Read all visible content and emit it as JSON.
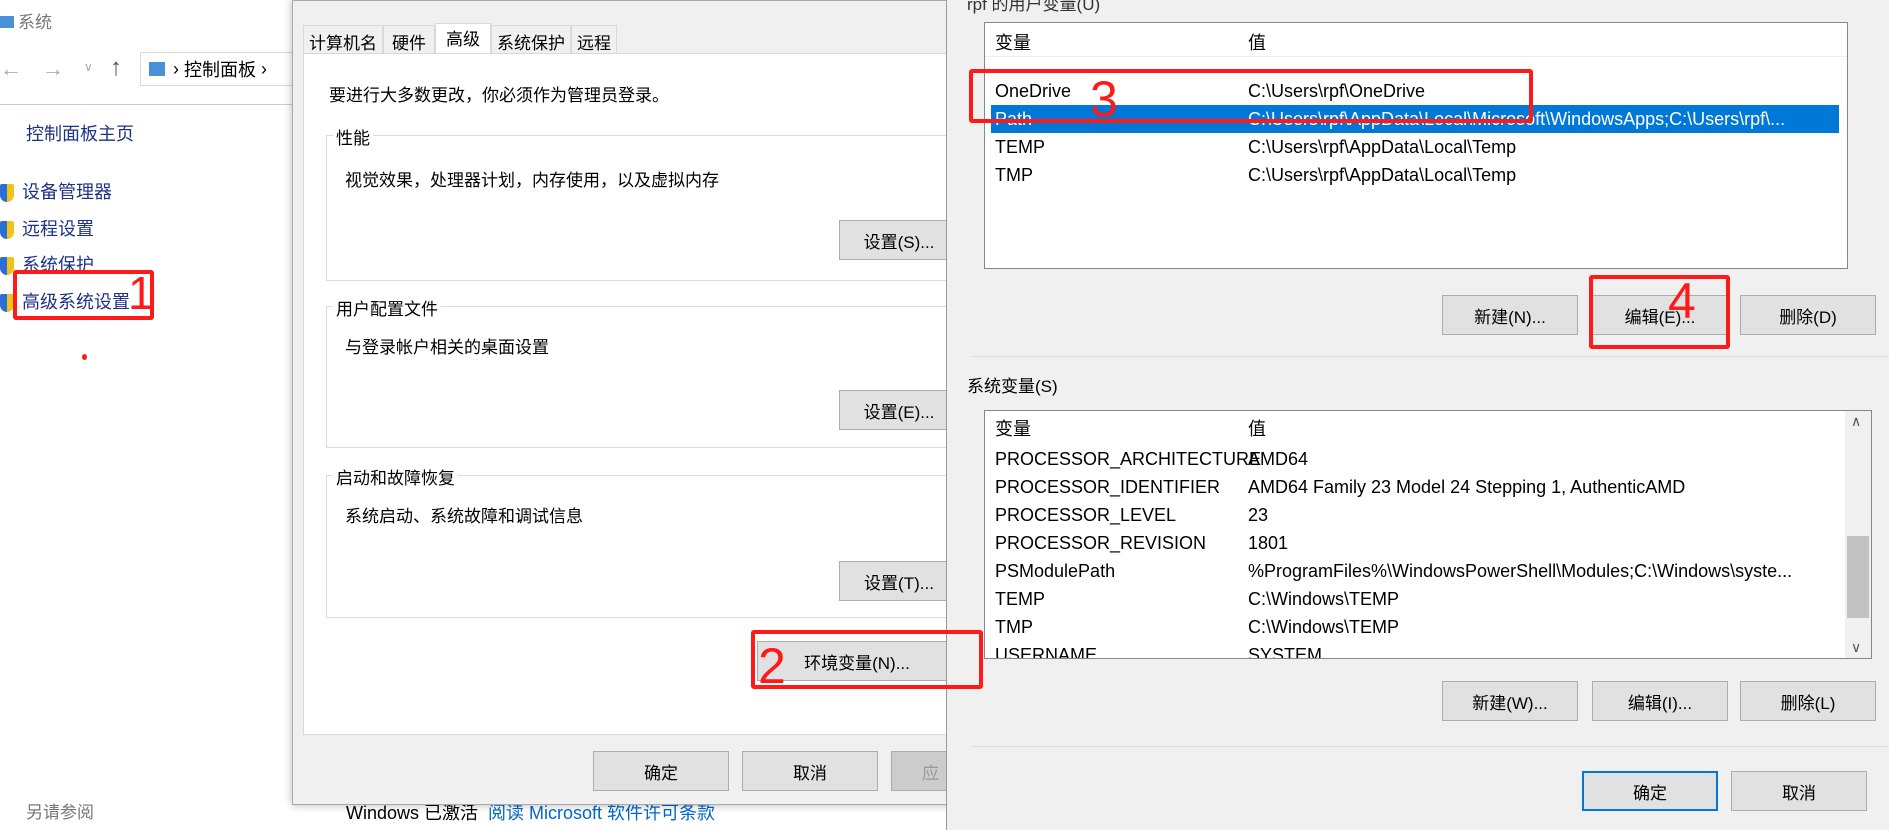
{
  "explorer": {
    "title": "系统",
    "breadcrumb": "控制面板",
    "home": "控制面板主页",
    "items": [
      "设备管理器",
      "远程设置",
      "系统保护",
      "高级系统设置"
    ],
    "see_also": "另请参阅",
    "activation": "Windows 已激活",
    "license_link": "阅读 Microsoft 软件许可条款"
  },
  "sysprops": {
    "tabs": [
      "计算机名",
      "硬件",
      "高级",
      "系统保护",
      "远程"
    ],
    "active_tab": "高级",
    "admin_note": "要进行大多数更改，你必须作为管理员登录。",
    "groups": [
      {
        "title": "性能",
        "desc": "视觉效果，处理器计划，内存使用，以及虚拟内存",
        "button": "设置(S)..."
      },
      {
        "title": "用户配置文件",
        "desc": "与登录帐户相关的桌面设置",
        "button": "设置(E)..."
      },
      {
        "title": "启动和故障恢复",
        "desc": "系统启动、系统故障和调试信息",
        "button": "设置(T)..."
      }
    ],
    "env_button": "环境变量(N)...",
    "ok": "确定",
    "cancel": "取消",
    "apply": "应"
  },
  "envvars": {
    "user_label": "rpf 的用户变量(U)",
    "col_var": "变量",
    "col_val": "值",
    "user_vars": [
      {
        "name": "OneDrive",
        "value": "C:\\Users\\rpf\\OneDrive"
      },
      {
        "name": "Path",
        "value": "C:\\Users\\rpf\\AppData\\Local\\Microsoft\\WindowsApps;C:\\Users\\rpf\\..."
      },
      {
        "name": "TEMP",
        "value": "C:\\Users\\rpf\\AppData\\Local\\Temp"
      },
      {
        "name": "TMP",
        "value": "C:\\Users\\rpf\\AppData\\Local\\Temp"
      }
    ],
    "user_buttons": [
      "新建(N)...",
      "编辑(E)...",
      "删除(D)"
    ],
    "sys_label": "系统变量(S)",
    "sys_vars": [
      {
        "name": "PROCESSOR_ARCHITECTURE",
        "value": "AMD64"
      },
      {
        "name": "PROCESSOR_IDENTIFIER",
        "value": "AMD64 Family 23 Model 24 Stepping 1, AuthenticAMD"
      },
      {
        "name": "PROCESSOR_LEVEL",
        "value": "23"
      },
      {
        "name": "PROCESSOR_REVISION",
        "value": "1801"
      },
      {
        "name": "PSModulePath",
        "value": "%ProgramFiles%\\WindowsPowerShell\\Modules;C:\\Windows\\syste..."
      },
      {
        "name": "TEMP",
        "value": "C:\\Windows\\TEMP"
      },
      {
        "name": "TMP",
        "value": "C:\\Windows\\TEMP"
      },
      {
        "name": "USERNAME",
        "value": "SYSTEM"
      }
    ],
    "sys_buttons": [
      "新建(W)...",
      "编辑(I)...",
      "删除(L)"
    ],
    "ok": "确定",
    "cancel": "取消"
  },
  "annotations": [
    "1",
    "2",
    "3",
    "4"
  ],
  "colors": {
    "selection": "#0078d7",
    "annotation": "#ff1a1a",
    "link": "#0066cc"
  }
}
